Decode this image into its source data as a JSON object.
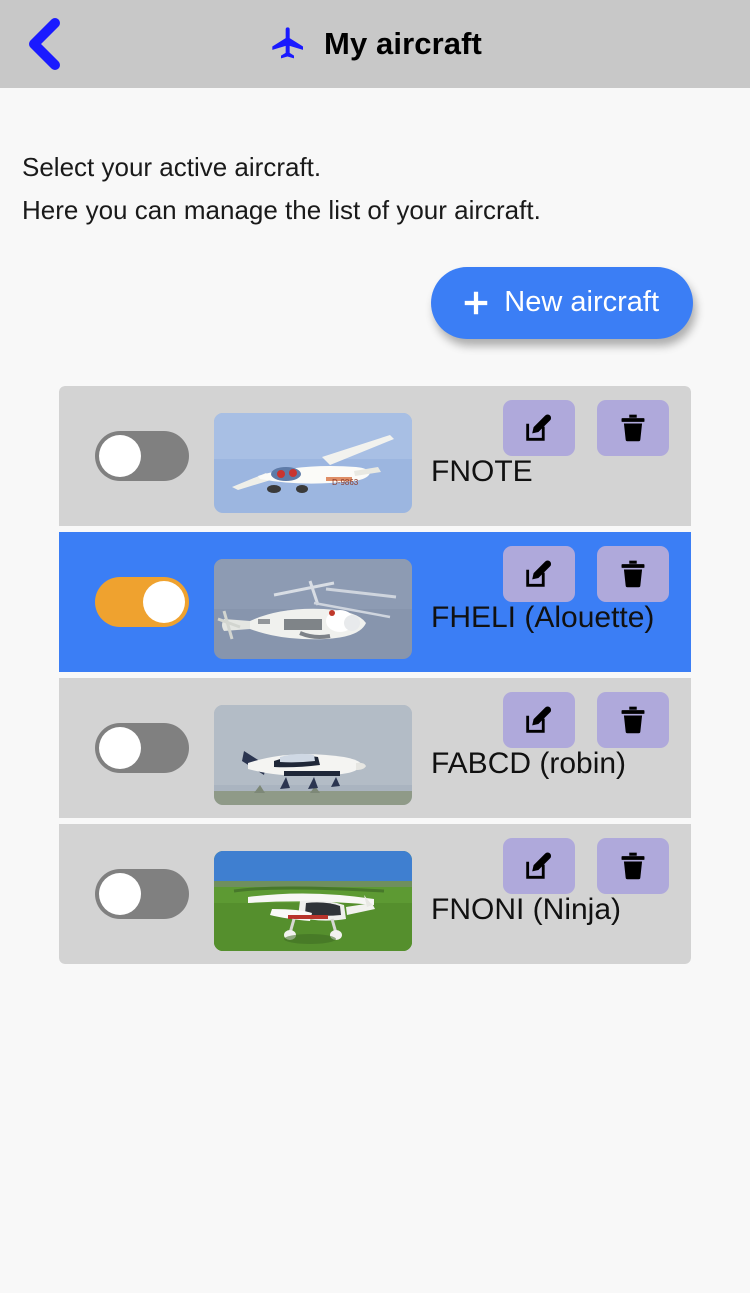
{
  "header": {
    "back_icon": "chevron-left-icon",
    "title_icon": "airplane-icon",
    "title": "My aircraft",
    "accent_color": "#1a1aff",
    "bar_color": "#c8c8c8"
  },
  "intro": {
    "line1": "Select your active aircraft.",
    "line2": "Here you can manage the list of your aircraft."
  },
  "toolbar": {
    "new_aircraft_label": "New aircraft",
    "new_aircraft_icon": "plus-icon",
    "new_aircraft_color": "#3b7ef5"
  },
  "list": {
    "row_color": "#d3d3d3",
    "active_row_color": "#3b7ef5",
    "toggle_on_color": "#efa22f",
    "toggle_off_color": "#808080",
    "icon_button_color": "#afa9db",
    "edit_icon": "edit-pencil-icon",
    "delete_icon": "trash-icon",
    "items": [
      {
        "label": "FNOTE",
        "active": false,
        "toggle_state": "off",
        "thumbnail": "glider-in-blue-sky"
      },
      {
        "label": "FHELI (Alouette)",
        "active": true,
        "toggle_state": "on",
        "thumbnail": "helicopter-in-grey-sky"
      },
      {
        "label": "FABCD (robin)",
        "active": false,
        "toggle_state": "off",
        "thumbnail": "light-aircraft-in-flight"
      },
      {
        "label": "FNONI (Ninja)",
        "active": false,
        "toggle_state": "off",
        "thumbnail": "ultralight-on-grass"
      }
    ]
  }
}
